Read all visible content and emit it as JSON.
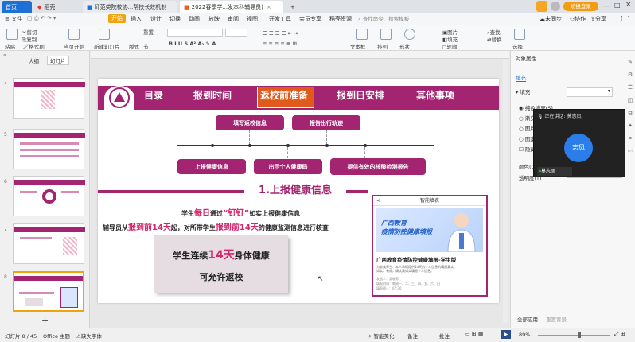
{
  "tabs": {
    "home": "首页",
    "docer": "稻壳",
    "doc1": "师范类院校协...帮扶长效机制",
    "doc2": "2022春季学...发本科辅导员)",
    "add": "+",
    "user": "切换登录"
  },
  "menu": {
    "file": "≡ 文件",
    "items": [
      "开始",
      "插入",
      "设计",
      "切换",
      "动画",
      "放映",
      "审阅",
      "视图",
      "开发工具",
      "会员专享",
      "稻壳资源"
    ],
    "search": "查找命令、搜索模板",
    "sync": "未同步",
    "collab": "协作",
    "share": "分享"
  },
  "toolbar": {
    "cut": "剪切",
    "copy": "复制",
    "format": "格式刷",
    "paste": "粘贴",
    "from_current": "当页开始",
    "new_slide": "新建幻灯片",
    "layout": "版式",
    "section": "节",
    "reset": "重置",
    "textbox": "文本框",
    "shape": "形状",
    "arrange": "排列",
    "picture": "图片",
    "fill": "填充",
    "find": "查找",
    "replace": "替换",
    "select": "选择",
    "outline": "轮廓"
  },
  "left_panel": {
    "tab_outline": "大纲",
    "tab_slides": "幻灯片",
    "slide_numbers": [
      "4",
      "5",
      "6",
      "7",
      "8"
    ],
    "add": "+"
  },
  "slide": {
    "nav": [
      "目录",
      "报到时间",
      "返校前准备",
      "报到日安排",
      "其他事项"
    ],
    "flow_top": [
      "填写返校信息",
      "报告出行轨迹"
    ],
    "flow_bottom": [
      "上报健康信息",
      "出示个人健康码",
      "提供有效的核酸检测报告"
    ],
    "section_title": "1.上报健康信息",
    "line1": {
      "a": "学生",
      "b": "每日",
      "c": "通过",
      "d": "“钉钉”",
      "e": "如实上报健康信息"
    },
    "line2": {
      "a": "辅导员从",
      "b": "报到前14天",
      "c": "起，对所带学生",
      "d": "报到前14天",
      "e": "的健康监测信息进行核查"
    },
    "box": {
      "a": "学生连续",
      "b": "14天",
      "c": "身体健康",
      "d": "可允许返校"
    },
    "phone": {
      "header": "智能填表",
      "back": "<",
      "banner": "广西教育\n疫情防控健康填报",
      "title": "广西教育疫情防控健康填报-学生版",
      "desc": "为收集师生、本人承诺提供14天内个人信息的填报真实、如实、有效。请认真如实填报个人信息。",
      "meta1": "发起人：吴晓芳",
      "meta2": "填报时间：每周一、二、三、四、五、六、日",
      "meta3": "填报截止：07:30"
    }
  },
  "right_panel": {
    "title": "对象属性",
    "tab": "填充",
    "section_fill": "填充",
    "options": [
      "纯色填充(S)",
      "渐变填充",
      "图片或纹理填充",
      "图案填充",
      "隐藏背景图形"
    ],
    "color_label": "颜色(C)",
    "transparency_label": "透明度(T)",
    "apply_all": "全部应用",
    "reset_bg": "重置背景"
  },
  "meeting": {
    "speaking": "正在讲话: 莫志凤;",
    "avatar_text": "志凤",
    "name": "莫志凤"
  },
  "status": {
    "slide_pos": "幻灯片 8 / 45",
    "theme": "Office 主题",
    "font_missing": "缺失字体",
    "smart": "智能美化",
    "notes": "备注",
    "comment": "批注",
    "zoom": "89%"
  },
  "colors": {
    "accent": "#a32471",
    "wps_orange": "#f05a24",
    "start_tab": "#f0a30a"
  }
}
